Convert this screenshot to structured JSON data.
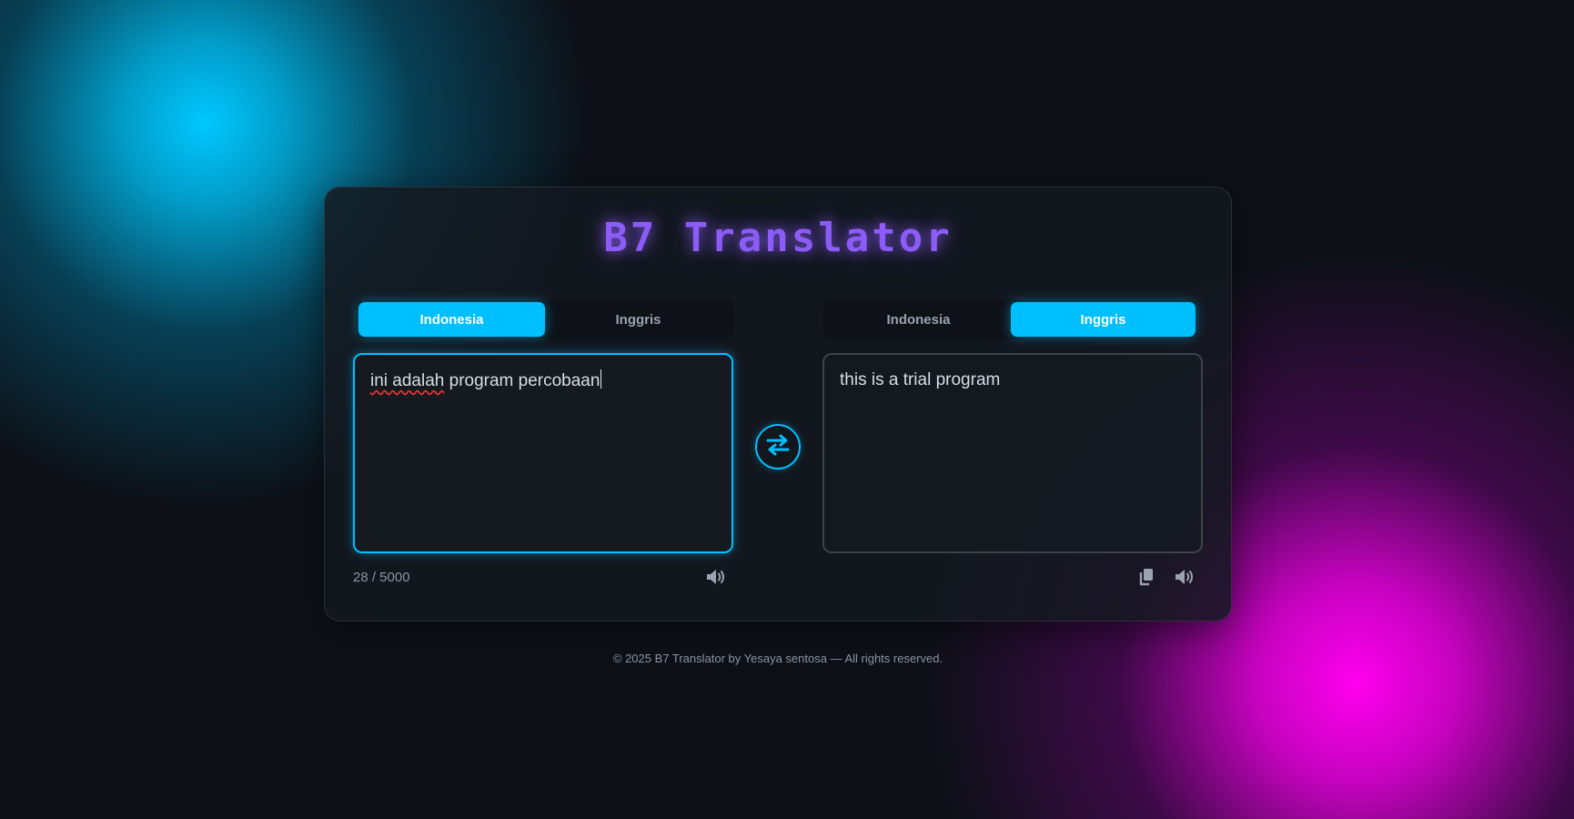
{
  "app": {
    "title": "B7 Translator"
  },
  "source": {
    "tabs": [
      {
        "label": "Indonesia",
        "active": true
      },
      {
        "label": "Inggris",
        "active": false
      }
    ],
    "text_before_error": "",
    "misspelled_word": "ini adalah",
    "text_after_error": " program percobaan",
    "char_count": "28 / 5000",
    "speak_icon": "speaker-icon"
  },
  "target": {
    "tabs": [
      {
        "label": "Indonesia",
        "active": false
      },
      {
        "label": "Inggris",
        "active": true
      }
    ],
    "text": "this is a trial program",
    "copy_icon": "copy-icon",
    "speak_icon": "speaker-icon"
  },
  "swap": {
    "icon": "swap-arrows-icon"
  },
  "footer": {
    "text": "© 2025 B7 Translator by Yesaya sentosa — All rights reserved."
  },
  "colors": {
    "accent": "#00bfff",
    "title": "#8b5cf6",
    "background": "#0d1117",
    "blob_cyan": "#00c8ff",
    "blob_magenta": "#ff00ee"
  }
}
